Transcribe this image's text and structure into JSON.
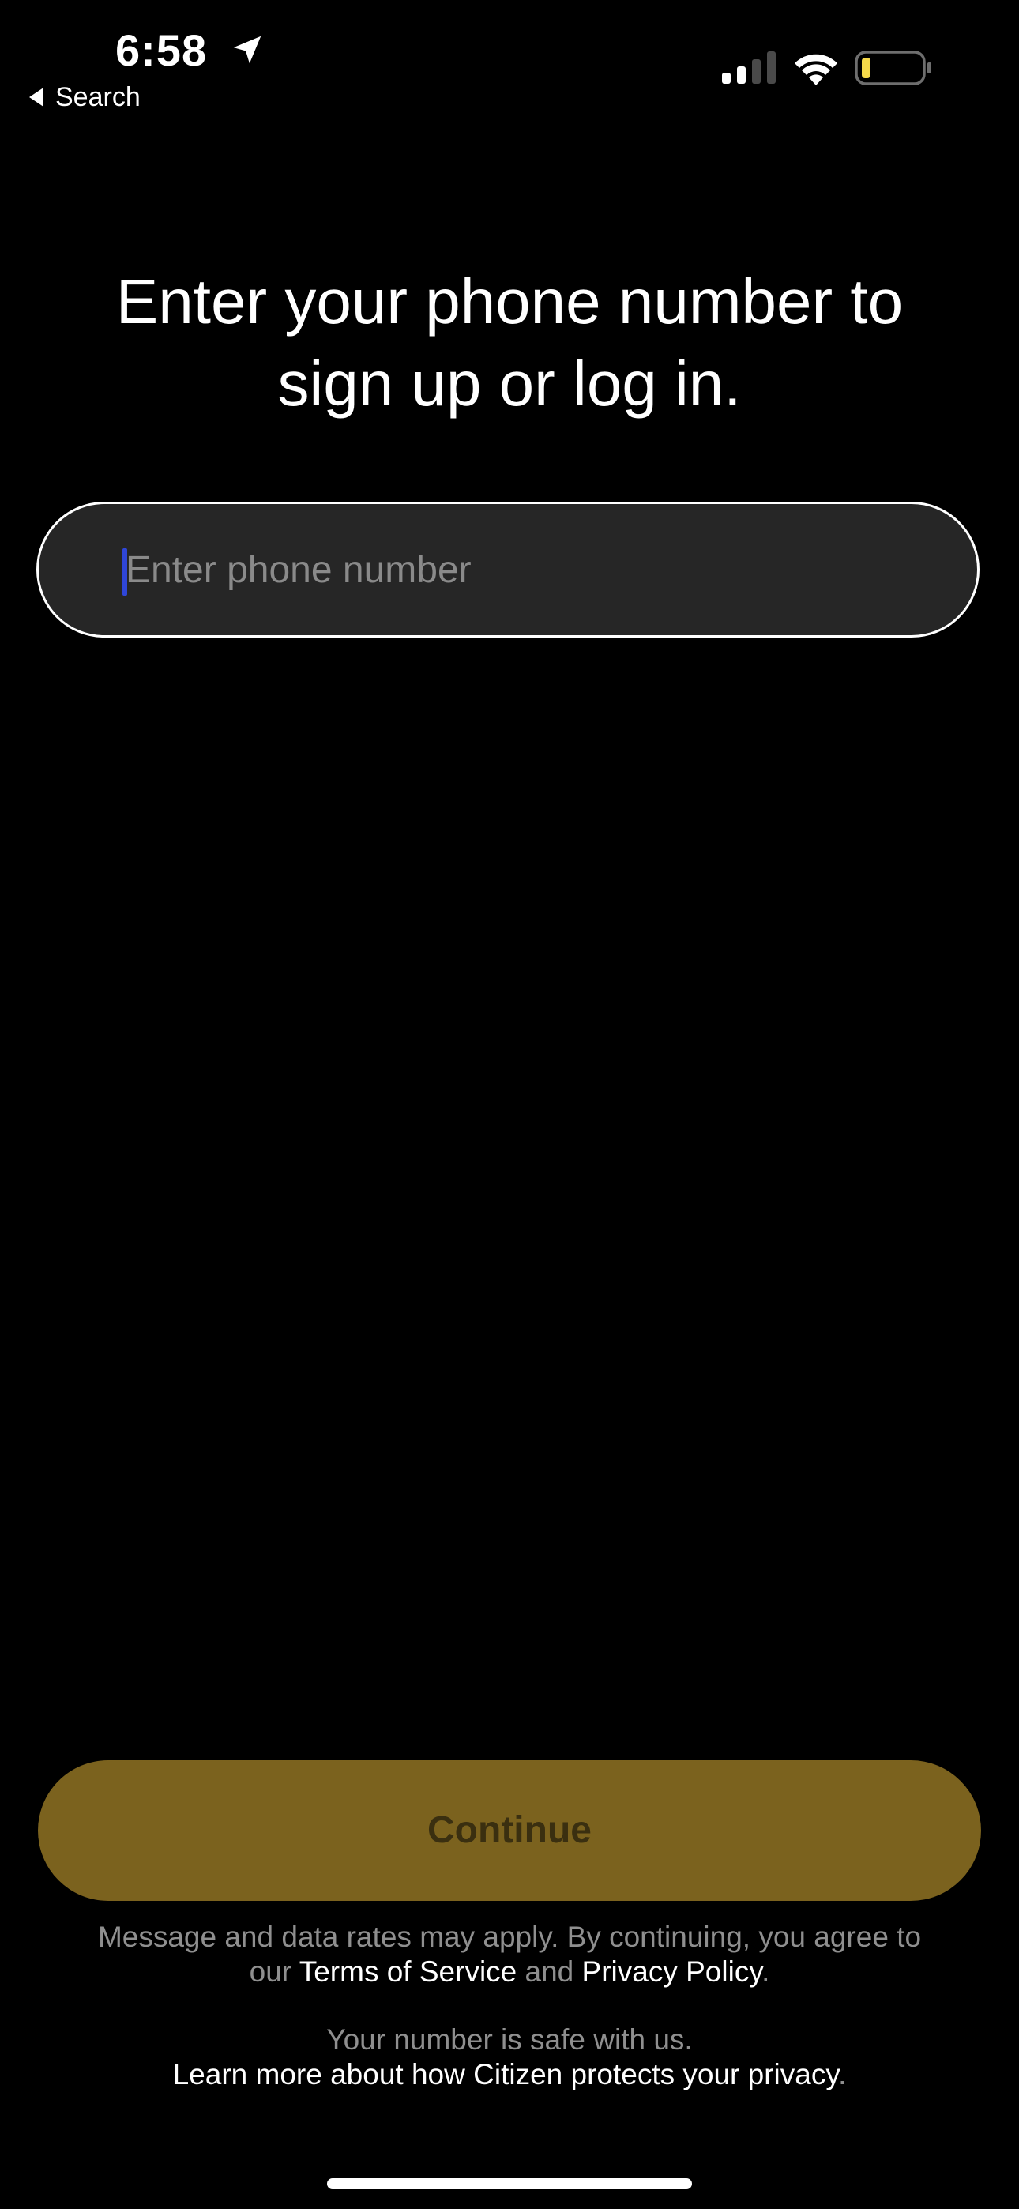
{
  "status_bar": {
    "time": "6:58",
    "back_label": "Search",
    "icons": [
      "location-arrow-icon",
      "cellular-signal-icon",
      "wifi-icon",
      "battery-icon"
    ],
    "battery_fill_color": "#f5d94a",
    "signal_bars_active": 2,
    "signal_bars_total": 4
  },
  "heading": {
    "line1": "Enter your phone number to",
    "line2": "sign up or log in."
  },
  "phone_input": {
    "placeholder": "Enter phone number",
    "value": "",
    "cursor_color": "#2f46d8"
  },
  "continue_button": {
    "label": "Continue",
    "background_color": "#7b621e",
    "text_color": "#3a2f10"
  },
  "legal": {
    "line1": "Message and data rates may apply. By continuing, you agree to",
    "line2_prefix": "our ",
    "terms_link": "Terms of Service",
    "connector": " and ",
    "privacy_policy_link": "Privacy Policy",
    "line2_suffix": "."
  },
  "privacy_note": {
    "safe_text": "Your number is safe with us.",
    "learn_more_link": "Learn more about how Citizen protects your privacy",
    "learn_more_suffix": "."
  },
  "colors": {
    "background": "#000000",
    "input_background": "#262626",
    "muted_text": "#8f8f8f"
  }
}
